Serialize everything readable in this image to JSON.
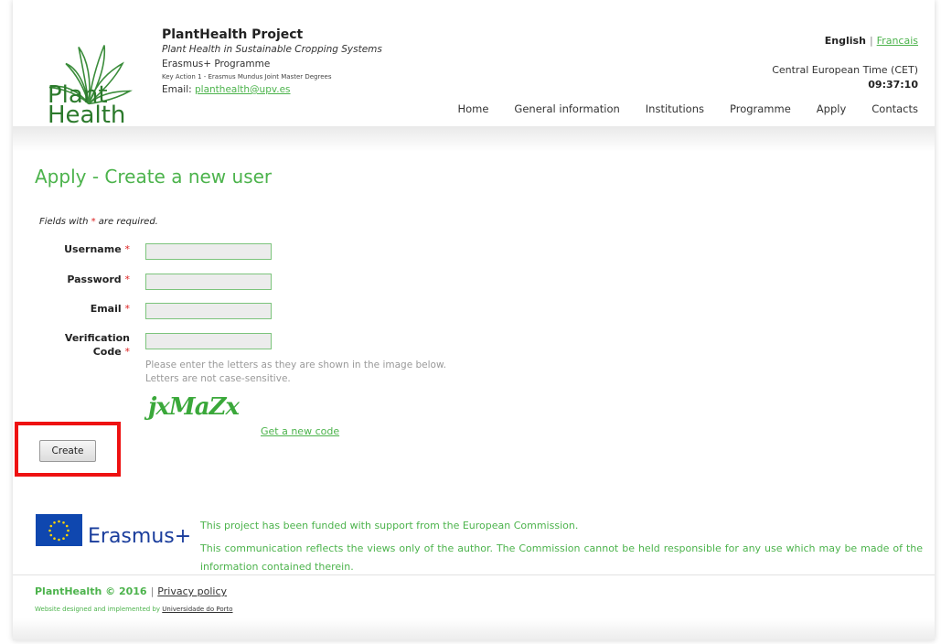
{
  "header": {
    "logo_line1": "Plant",
    "logo_line2": "Health",
    "title": "PlantHealth Project",
    "subtitle": "Plant Health in Sustainable Cropping Systems",
    "programme": "Erasmus+ Programme",
    "key_action": "Key Action 1 - Erasmus Mundus Joint Master Degrees",
    "email_label": "Email:",
    "email": "planthealth@upv.es"
  },
  "lang": {
    "current": "English",
    "separator": "|",
    "other": "Francais"
  },
  "time": {
    "zone": "Central European Time (CET)",
    "clock": "09:37:10"
  },
  "nav": {
    "items": [
      "Home",
      "General information",
      "Institutions",
      "Programme",
      "Apply",
      "Contacts"
    ]
  },
  "page": {
    "title": "Apply - Create a new user",
    "required_prefix": "Fields with ",
    "required_star": "*",
    "required_suffix": " are required."
  },
  "form": {
    "username_label": "Username",
    "password_label": "Password",
    "email_label": "Email",
    "verification_label_1": "Verification",
    "verification_label_2": "Code",
    "star": "*",
    "username_value": "",
    "password_value": "",
    "email_value": "",
    "code_value": "",
    "hint_1": "Please enter the letters as they are shown in the image below.",
    "hint_2": "Letters are not case-sensitive.",
    "captcha_text": "jxMaZx",
    "new_code_link": "Get a new code",
    "create_button": "Create"
  },
  "footer": {
    "erasmus_label": "Erasmus+",
    "funding_1": "This project has been funded with support from the European Commission.",
    "funding_2": "This communication reflects the views only of the author. The Commission cannot be held responsible for any use which may be made of the information contained therein.",
    "copyright": "PlantHealth © 2016",
    "sep": "|",
    "privacy": "Privacy policy",
    "credit_prefix": "Website designed and implemented by ",
    "credit_link": "Universidade do Porto"
  },
  "colors": {
    "accent_green": "#4cb34c",
    "highlight_red": "#ee1111",
    "eu_blue": "#0f47af"
  }
}
